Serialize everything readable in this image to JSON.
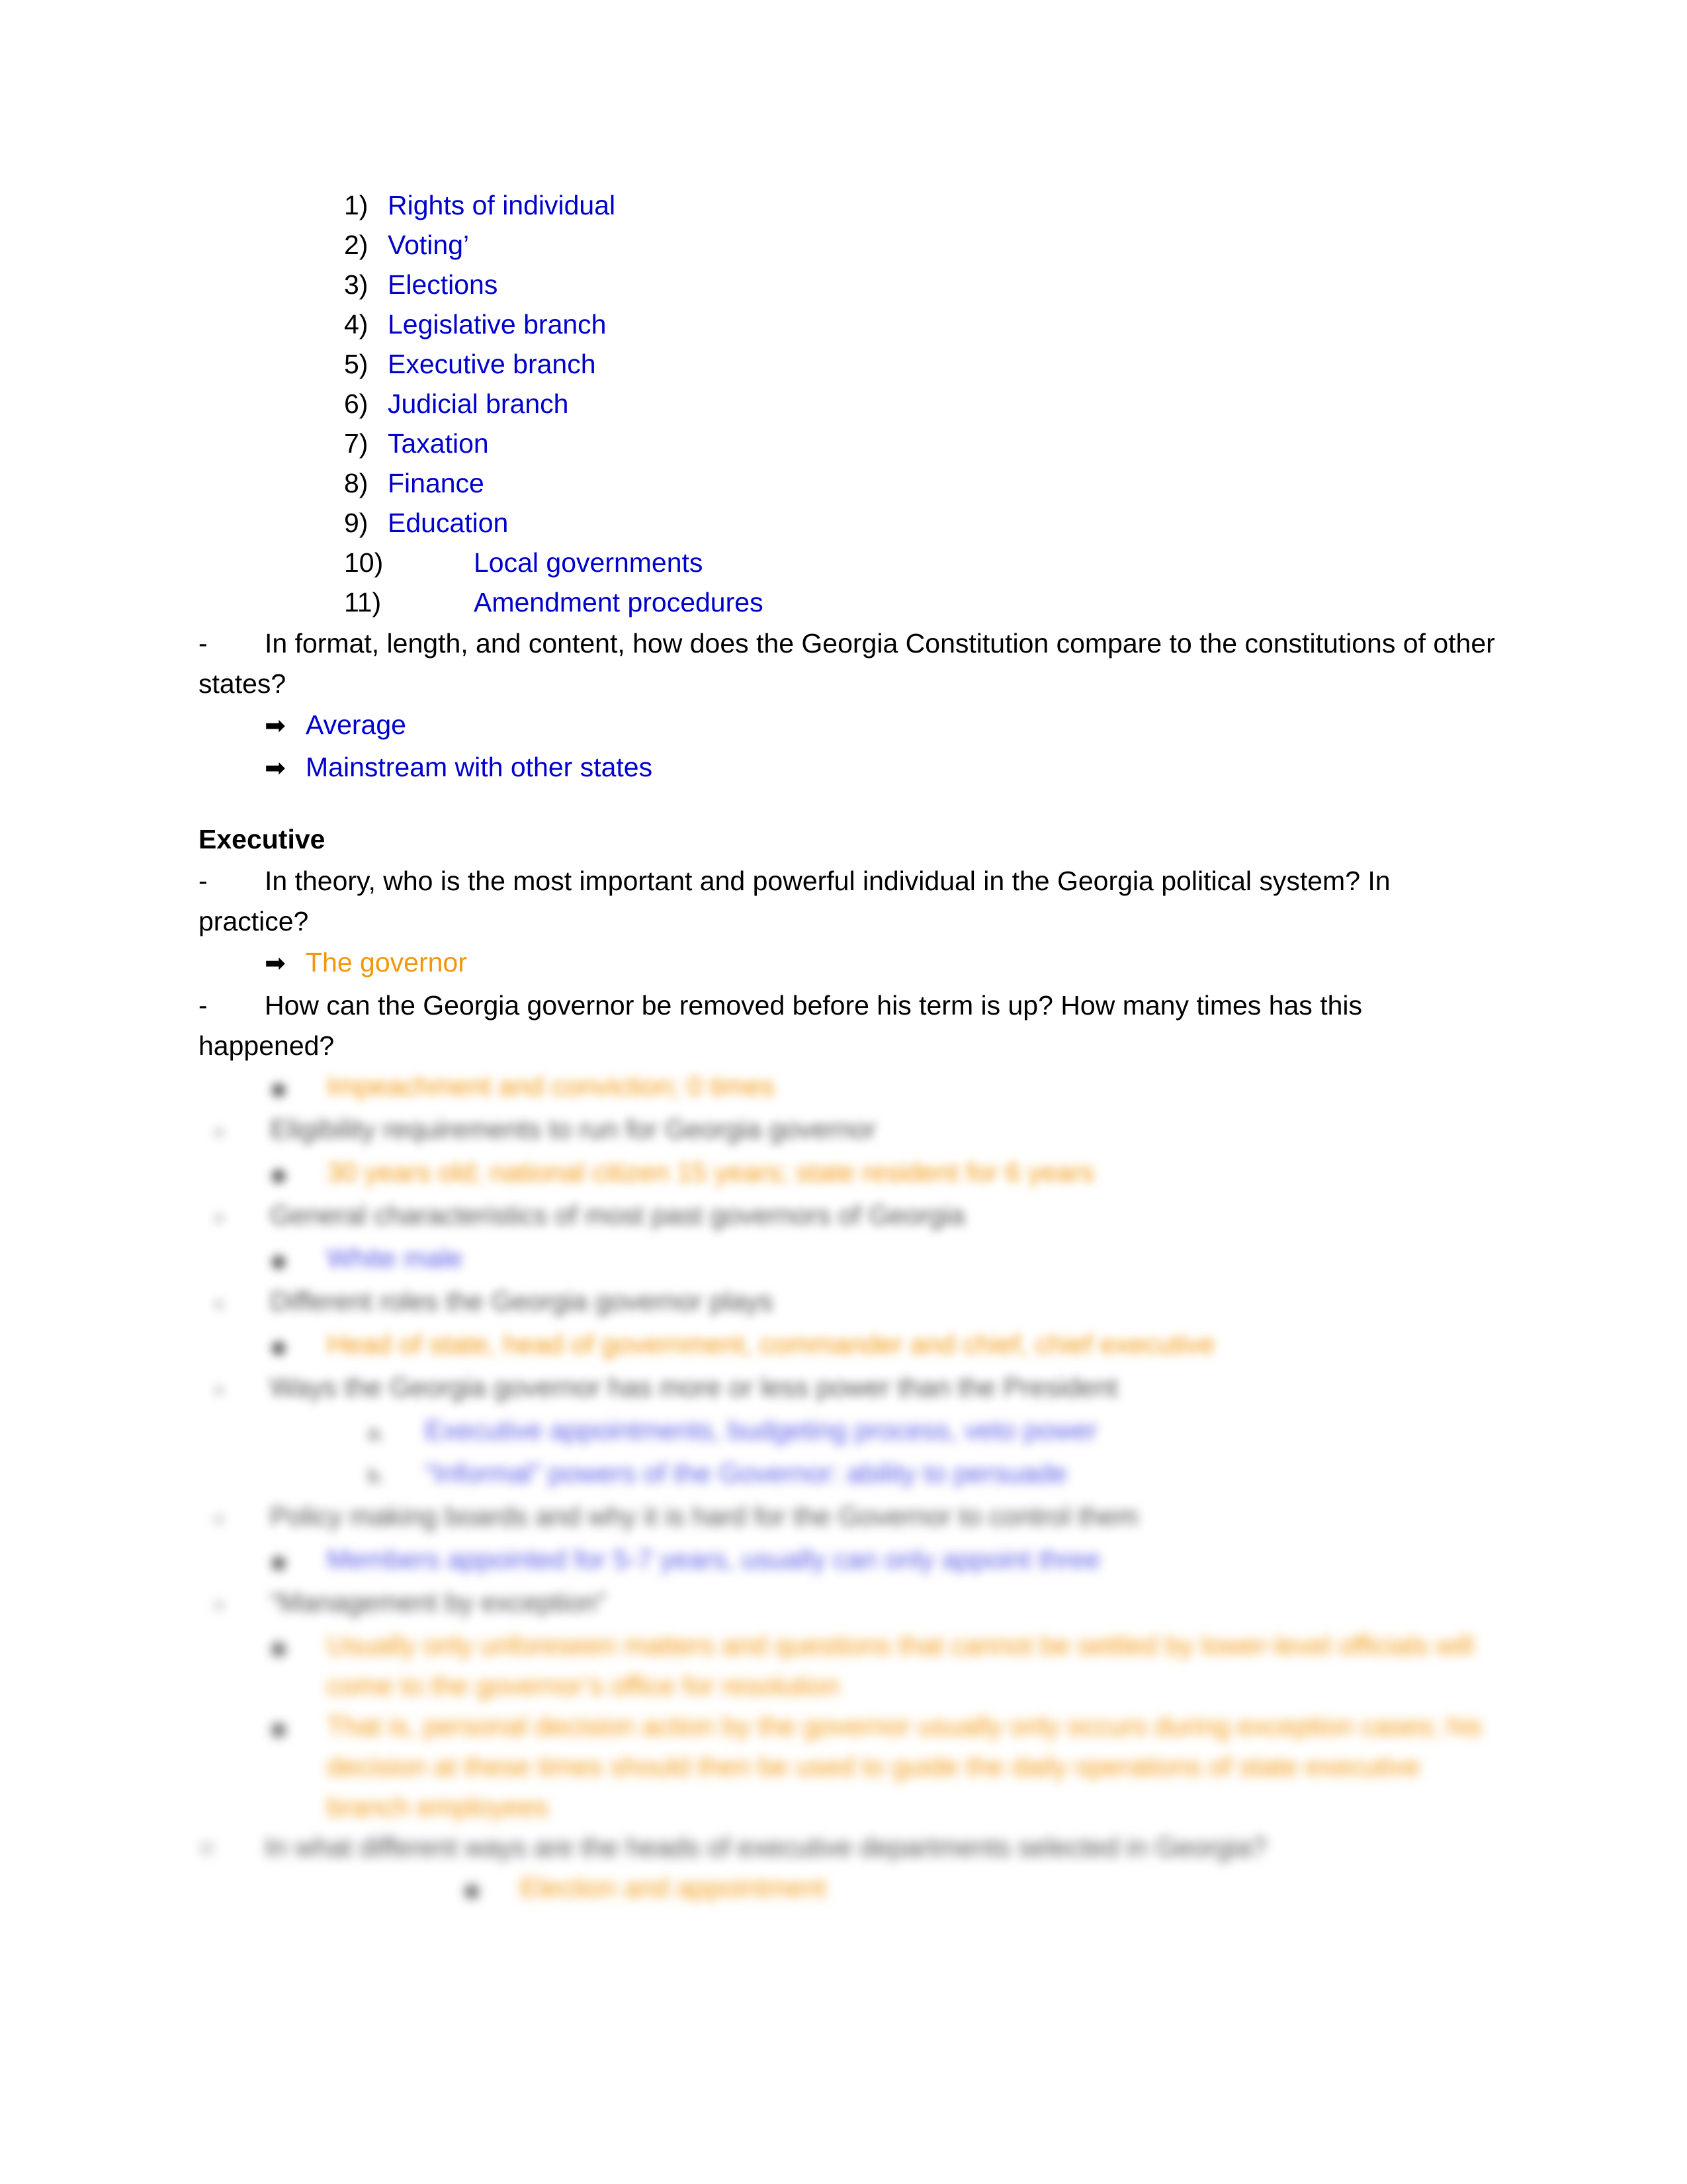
{
  "document": {
    "numbered_list": [
      {
        "marker": "1)",
        "text": "Rights of individual"
      },
      {
        "marker": "2)",
        "text": "Voting’"
      },
      {
        "marker": "3)",
        "text": "Elections"
      },
      {
        "marker": "4)",
        "text": "Legislative branch"
      },
      {
        "marker": "5)",
        "text": " Executive branch"
      },
      {
        "marker": "6)",
        "text": "Judicial branch"
      },
      {
        "marker": "7)",
        "text": "Taxation"
      },
      {
        "marker": "8)",
        "text": "Finance"
      },
      {
        "marker": "9)",
        "text": "Education"
      },
      {
        "marker": "10)",
        "text": "Local governments"
      },
      {
        "marker": "11)",
        "text": "Amendment procedures"
      }
    ],
    "question_1": "In format, length, and content, how does the Georgia Constitution compare to the constitutions of other states?",
    "answers_1": [
      "Average",
      "Mainstream with other states"
    ],
    "section_heading": "Executive",
    "question_2": "In theory, who is the most important and powerful individual in the Georgia political system? In practice?",
    "answer_2": "The governor",
    "question_3": "How can the Georgia governor be removed before his term is up? How many times has this happened?",
    "blurred_items": [
      {
        "level": "lvl2",
        "marker": "◉",
        "style": "hl-o",
        "lines": [
          "Impeachment and conviction; 0 times"
        ]
      },
      {
        "level": "lvl1",
        "marker": "○",
        "style": "blk",
        "lines": [
          "Eligibility requirements to run for Georgia governor"
        ]
      },
      {
        "level": "lvl2",
        "marker": "◉",
        "style": "hl-o",
        "lines": [
          "30 years old; national citizen 15 years; state resident for 6 years"
        ]
      },
      {
        "level": "lvl1",
        "marker": "○",
        "style": "blk",
        "lines": [
          "General characteristics of most past governors of Georgia"
        ]
      },
      {
        "level": "lvl2",
        "marker": "◉",
        "style": "hl-b",
        "lines": [
          "White male"
        ]
      },
      {
        "level": "lvl1",
        "marker": "○",
        "style": "blk",
        "lines": [
          "Different roles the Georgia governor plays"
        ]
      },
      {
        "level": "lvl2",
        "marker": "◉",
        "style": "hl-o",
        "lines": [
          "Head of state, head of government, commander and chief, chief executive"
        ]
      },
      {
        "level": "lvl1",
        "marker": "○",
        "style": "blk",
        "lines": [
          "Ways the Georgia governor has more or less power than the President"
        ]
      },
      {
        "level": "lvl3",
        "marker": "a.",
        "style": "hl-b",
        "lines": [
          "Executive appointments, budgeting process, veto power"
        ]
      },
      {
        "level": "lvl3",
        "marker": "b.",
        "style": "hl-b",
        "lines": [
          "“Informal” powers of the Governor: ability to persuade"
        ]
      },
      {
        "level": "lvl1",
        "marker": "○",
        "style": "blk",
        "lines": [
          "Policy making boards and why it is hard for the Governor to control them"
        ]
      },
      {
        "level": "lvl2",
        "marker": "◉",
        "style": "hl-b",
        "lines": [
          "Members appointed for 5-7 years, usually can only appoint three"
        ]
      },
      {
        "level": "lvl1",
        "marker": "○",
        "style": "blk",
        "lines": [
          "“Management by exception”"
        ]
      },
      {
        "level": "lvl2",
        "marker": "◉",
        "style": "hl-o",
        "lines": [
          "Usually only unforeseen matters and questions that cannot be settled by lower-level officials will come to the governor’s office for resolution"
        ]
      },
      {
        "level": "lvl2",
        "marker": "◉",
        "style": "hl-o",
        "lines": [
          "That is, personal decision action by the governor usually only occurs during exception cases; his decision at these times should then be used to guide the daily operations of state executive branch employees"
        ]
      }
    ],
    "question_4": "In what different ways are the heads of executive departments selected in Georgia?",
    "blurred_final": {
      "level": "lvl4",
      "marker": "◉",
      "style": "hl-o",
      "lines": [
        "Election and appointment"
      ]
    }
  }
}
